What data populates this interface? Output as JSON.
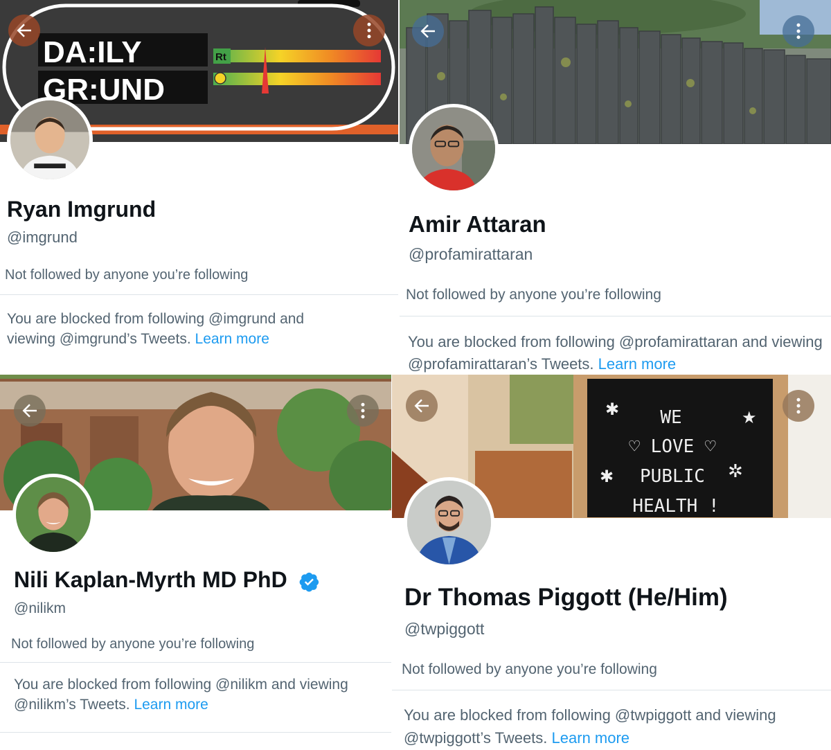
{
  "profiles": [
    {
      "banner": {
        "line1": "DA:ILY",
        "line2": "GR:UND",
        "meter1": "Rt"
      },
      "name": "Ryan Imgrund",
      "handle": "@imgrund",
      "followed": "Not followed by anyone you’re following",
      "blocked_pre": "You are blocked from following @imgrund and viewing @imgrund’s Tweets.",
      "learn_more": "Learn more"
    },
    {
      "name": "Amir Attaran",
      "handle": "@profamirattaran",
      "followed": "Not followed by anyone you’re following",
      "blocked_pre": "You are blocked from following @profamirattaran and viewing @profamirattaran’s Tweets.",
      "learn_more": "Learn more"
    },
    {
      "name": "Nili Kaplan-Myrth MD PhD",
      "verified": true,
      "handle": "@nilikm",
      "followed": "Not followed by anyone you’re following",
      "blocked_pre": "You are blocked from following @nilikm and viewing @nilikm’s Tweets.",
      "learn_more": "Learn more"
    },
    {
      "banner": {
        "sign1": "WE",
        "sign2": "♡ LOVE ♡",
        "sign3": "PUBLIC",
        "sign4": "HEALTH !"
      },
      "name": "Dr Thomas Piggott (He/Him)",
      "handle": "@twpiggott",
      "followed": "Not followed by anyone you’re following",
      "blocked_pre": "You are blocked from following @twpiggott and viewing @twpiggott’s Tweets.",
      "learn_more": "Learn more"
    }
  ],
  "icons": {
    "back": "back-arrow-icon",
    "more": "more-vertical-icon",
    "verified": "verified-badge-icon"
  },
  "colors": {
    "link": "#1d9bf0",
    "secondary_text": "#536471",
    "primary_text": "#0f1419",
    "verified": "#1d9bf0"
  }
}
